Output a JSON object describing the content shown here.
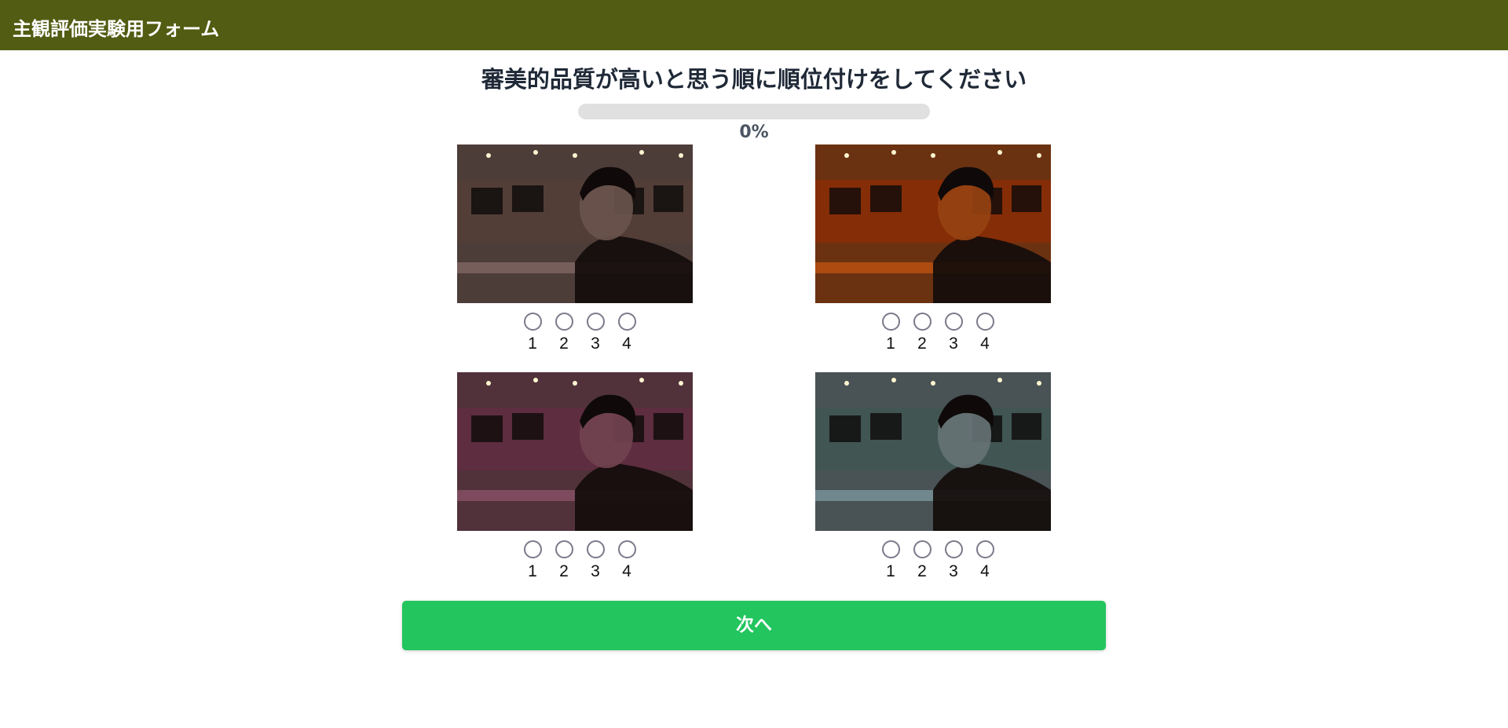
{
  "header": {
    "title": "主観評価実験用フォーム"
  },
  "question": {
    "title": "審美的品質が高いと思う順に順位付けをしてください"
  },
  "progress": {
    "value": 0,
    "text": "0%"
  },
  "rank_options": [
    "1",
    "2",
    "3",
    "4"
  ],
  "images": [
    {
      "tint": "#a98a84",
      "accent": "#5a4037"
    },
    {
      "tint": "#ff6a10",
      "accent": "#9a2a00"
    },
    {
      "tint": "#b56a8a",
      "accent": "#6a2a44"
    },
    {
      "tint": "#9fc7d4",
      "accent": "#3a5a52"
    }
  ],
  "next_button": {
    "label": "次へ"
  },
  "colors": {
    "header_bg": "#525c12",
    "button_bg": "#22c55e",
    "progress_track": "#e0e0e0"
  }
}
